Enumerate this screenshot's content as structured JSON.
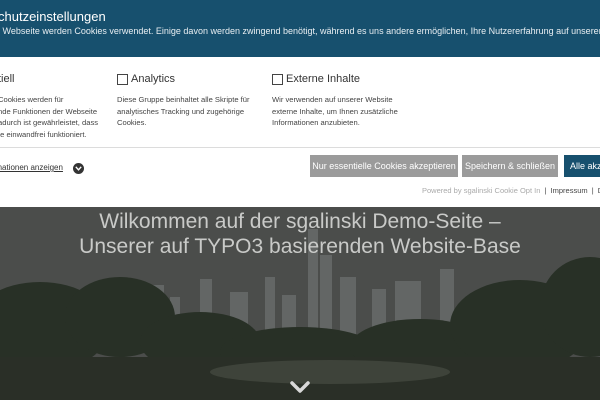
{
  "banner": {
    "title": "Datenschutzeinstellungen",
    "title_visible": "chutzeinstellungen",
    "description": "r Webseite werden Cookies verwendet. Einige davon werden zwingend benötigt, während es uns andere ermöglichen, Ihre Nutzererfahrung auf unserer Webseite zu verbessern."
  },
  "groups": [
    {
      "label": "tiell",
      "checked": true,
      "text": [
        "Cookies werden für",
        "nde Funktionen der Webseite",
        "adurch ist gewährleistet, dass",
        "te einwandfrei funktioniert."
      ]
    },
    {
      "label": "Analytics",
      "checked": false,
      "text": [
        "Diese Gruppe beinhaltet alle Skripte für",
        "analytisches Tracking und zugehörige",
        "Cookies."
      ]
    },
    {
      "label": "Externe Inhalte",
      "checked": false,
      "text": [
        "Wir verwenden auf unserer Website",
        "externe Inhalte, um Ihnen zusätzliche",
        "Informationen anzubieten."
      ]
    }
  ],
  "more_info_label": "formationen anzeigen",
  "buttons": {
    "essential": "Nur essentielle Cookies akzeptieren",
    "save": "Speichern & schließen",
    "accept_all": "Alle akz"
  },
  "footer": {
    "powered": "Powered by sgalinski Cookie Opt In",
    "separator": "|",
    "impressum": "Impressum",
    "cut_link": "D"
  },
  "hero": {
    "line1": "Wilkommen auf der sgalinski Demo-Seite –",
    "line2": "Unserer auf TYPO3 basierenden Website-Base"
  },
  "colors": {
    "banner_blue": "#17506e",
    "button_grey": "#9b9b9b"
  },
  "icons": {
    "more_info": "chevron-down-icon",
    "scroll_down": "chevron-down-icon"
  }
}
